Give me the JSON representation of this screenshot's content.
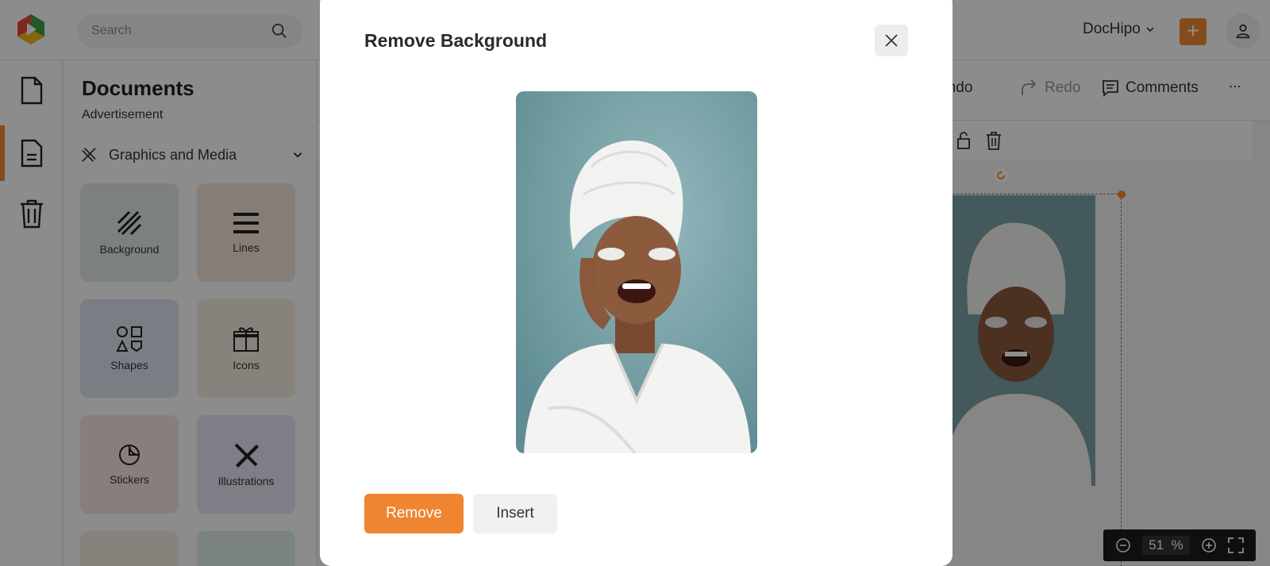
{
  "topbar": {
    "search_placeholder": "Search",
    "brand": "DocHipo",
    "plus_label": "+"
  },
  "panel": {
    "title": "Documents",
    "subtitle": "Advertisement",
    "section": "Graphics and Media",
    "tiles": [
      {
        "label": "Background",
        "icon": "background-icon",
        "color": "#e3ebe4"
      },
      {
        "label": "Lines",
        "icon": "lines-icon",
        "color": "#f6e3d9"
      },
      {
        "label": "Shapes",
        "icon": "shapes-icon",
        "color": "#dde6f3"
      },
      {
        "label": "Icons",
        "icon": "gift-icon",
        "color": "#f6ede0"
      },
      {
        "label": "Stickers",
        "icon": "sticker-icon",
        "color": "#f7e6e4"
      },
      {
        "label": "Illustrations",
        "icon": "pen-ruler-icon",
        "color": "#e7e4f2"
      }
    ]
  },
  "toolbar": {
    "undo": "Undo",
    "redo": "Redo",
    "comments": "Comments",
    "more": "..."
  },
  "zoom": {
    "value": "51",
    "unit": "%"
  },
  "modal": {
    "title": "Remove Background",
    "remove_label": "Remove",
    "insert_label": "Insert"
  },
  "colors": {
    "accent": "#ef8431",
    "overlay": "rgba(0,0,0,0.45)",
    "photo_bg": "#7aa3a8"
  }
}
